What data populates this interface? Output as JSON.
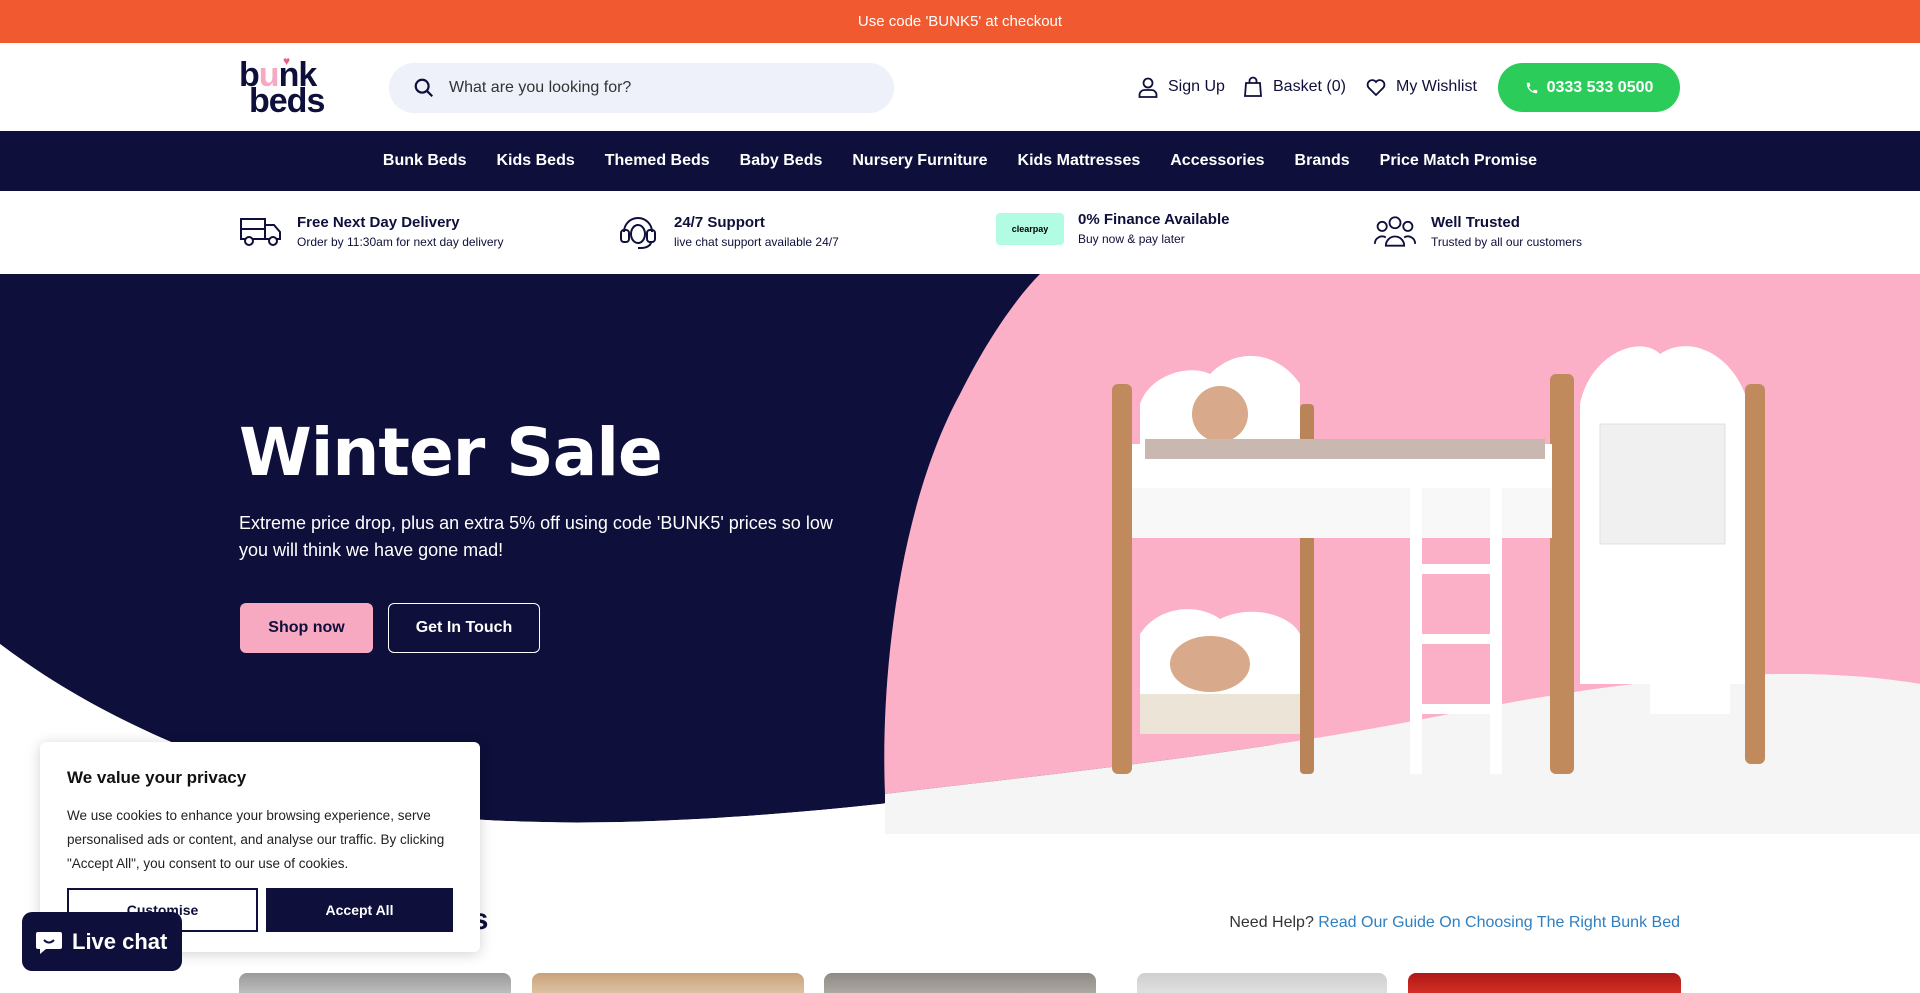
{
  "promo": {
    "text": "Use code 'BUNK5' at checkout"
  },
  "header": {
    "logo_line1_b": "b",
    "logo_line1_u": "u",
    "logo_line1_rest": "nk",
    "logo_line2": "beds",
    "search_placeholder": "What are you looking for?",
    "sign_up": "Sign Up",
    "basket": "Basket (0)",
    "wishlist": "My Wishlist",
    "phone": "0333 533 0500"
  },
  "nav": {
    "items": [
      "Bunk Beds",
      "Kids Beds",
      "Themed Beds",
      "Baby Beds",
      "Nursery Furniture",
      "Kids Mattresses",
      "Accessories",
      "Brands",
      "Price Match Promise"
    ]
  },
  "usps": [
    {
      "title": "Free Next Day Delivery",
      "subtitle": "Order by 11:30am for next day delivery",
      "icon": "truck-icon"
    },
    {
      "title": "24/7 Support",
      "subtitle": "live chat support available 24/7",
      "icon": "headset-icon"
    },
    {
      "title": "0% Finance Available",
      "subtitle": "Buy now & pay later",
      "icon": "clearpay-icon",
      "badge": "clearpay"
    },
    {
      "title": "Well Trusted",
      "subtitle": "Trusted by all our customers",
      "icon": "people-icon"
    }
  ],
  "hero": {
    "title": "Winter Sale",
    "text": "Extreme price drop, plus an extra 5% off using code 'BUNK5' prices so low you will think we have gone mad!",
    "shop_now": "Shop now",
    "get_in_touch": "Get In Touch"
  },
  "categories": {
    "title_partial": "ries",
    "help_prefix": "Need Help?",
    "help_link": "Read Our Guide On Choosing The Right Bunk Bed"
  },
  "cookie": {
    "title": "We value your privacy",
    "text": "We use cookies to enhance your browsing experience, serve personalised ads or content, and analyse our traffic. By clicking \"Accept All\", you consent to our use of cookies.",
    "customise": "Customise",
    "accept_all": "Accept All"
  },
  "live_chat": {
    "label": "Live chat"
  },
  "colors": {
    "brand_navy": "#0e0f3a",
    "promo_orange": "#f15a30",
    "hero_pink": "#fcb0c8",
    "accent_pink": "#f7a9c2",
    "phone_green": "#2bcc5a",
    "link_blue": "#2f7fc1"
  }
}
